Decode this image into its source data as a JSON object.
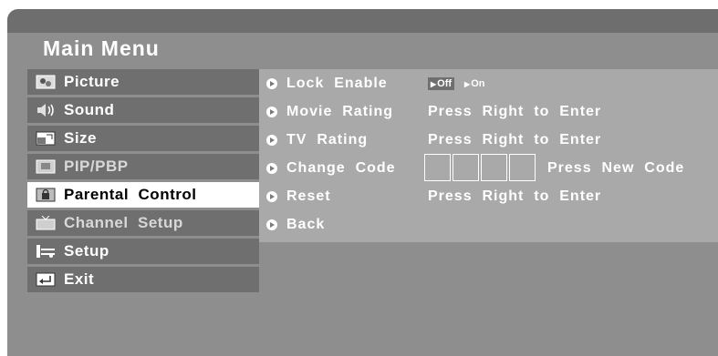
{
  "menu": {
    "title": "Main Menu"
  },
  "sidebar": {
    "items": [
      {
        "label": "Picture",
        "icon": "picture-icon",
        "active": false
      },
      {
        "label": "Sound",
        "icon": "speaker-icon",
        "active": false
      },
      {
        "label": "Size",
        "icon": "resize-icon",
        "active": false
      },
      {
        "label": "PIP/PBP",
        "icon": "pip-icon",
        "active": false
      },
      {
        "label": "Parental  Control",
        "icon": "lock-icon",
        "active": true
      },
      {
        "label": "Channel  Setup",
        "icon": "tv-icon",
        "active": false
      },
      {
        "label": "Setup",
        "icon": "setup-icon",
        "active": false
      },
      {
        "label": "Exit",
        "icon": "exit-icon",
        "active": false
      }
    ]
  },
  "panel": {
    "lock_enable": {
      "label": "Lock  Enable",
      "options": [
        "Off",
        "On"
      ],
      "selected": "Off"
    },
    "movie_rating": {
      "label": "Movie  Rating",
      "value": "Press  Right  to  Enter"
    },
    "tv_rating": {
      "label": "TV  Rating",
      "value": "Press  Right  to  Enter"
    },
    "change_code": {
      "label": "Change  Code",
      "value": "Press  New  Code"
    },
    "reset": {
      "label": "Reset",
      "value": "Press  Right  to  Enter"
    },
    "back": {
      "label": "Back"
    }
  },
  "colors": {
    "screen": "#8e8e8e",
    "panel": "#a9a9a9",
    "sidebar_item": "#6f6f6f",
    "active_item": "#ffffff"
  }
}
